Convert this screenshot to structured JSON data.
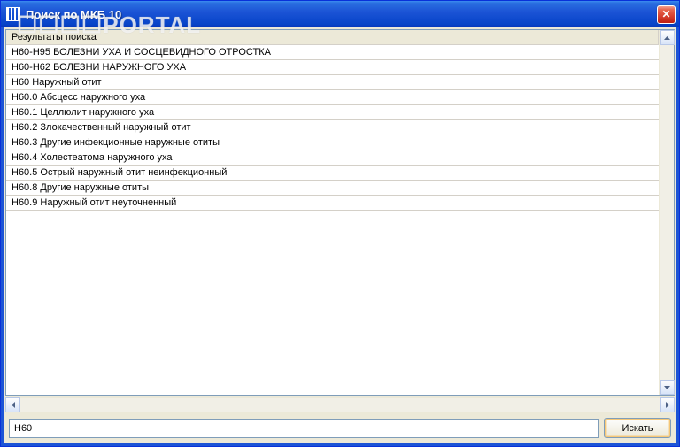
{
  "window": {
    "title": "Поиск по МКБ 10"
  },
  "watermark": "☐☐☐☐PORTAL",
  "results": {
    "header": "Результаты поиска",
    "rows": [
      "H60-H95 БОЛЕЗНИ УХА И СОСЦЕВИДНОГО ОТРОСТКА",
      "H60-H62 БОЛЕЗНИ НАРУЖНОГО УХА",
      "H60 Наружный отит",
      "H60.0 Абсцесс наружного уха",
      "H60.1 Целлюлит наружного уха",
      "H60.2 Злокачественный наружный отит",
      "H60.3 Другие инфекционные наружные отиты",
      "H60.4 Холестеатома наружного уха",
      "H60.5 Острый наружный отит неинфекционный",
      "H60.8 Другие наружные отиты",
      "H60.9 Наружный отит неуточненный"
    ]
  },
  "search": {
    "value": "H60",
    "button": "Искать"
  }
}
